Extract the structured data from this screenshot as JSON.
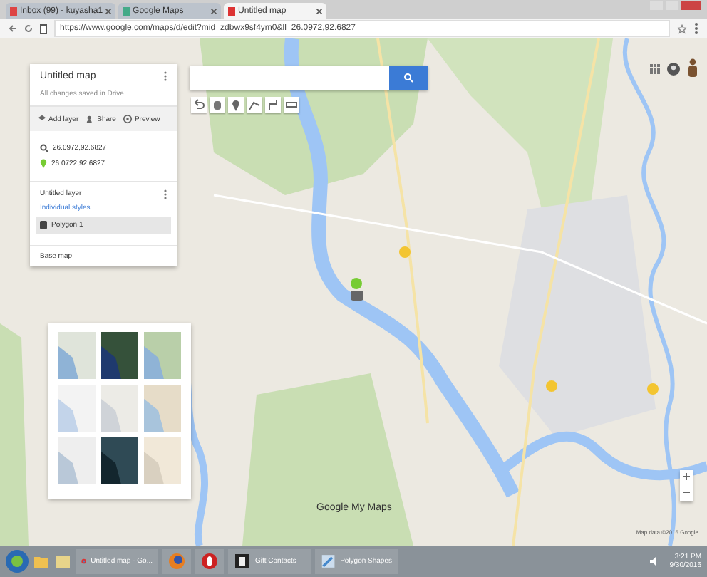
{
  "browser": {
    "tabs": [
      {
        "label": "Inbox (99) - kuyasha1",
        "selected": false
      },
      {
        "label": "Google Maps",
        "selected": false
      },
      {
        "label": "Untitled map",
        "selected": true
      }
    ],
    "url": "https://www.google.com/maps/d/edit?mid=zdbwx9sf4ym0&ll=26.0972,92.6827"
  },
  "map_panel": {
    "title": "Untitled map",
    "subtitle": "All changes saved in Drive",
    "actions": [
      {
        "kind": "layer",
        "label": "Add layer"
      },
      {
        "kind": "share",
        "label": "Share"
      },
      {
        "kind": "preview",
        "label": "Preview"
      }
    ],
    "directions": [
      {
        "kind": "search",
        "text": "26.0972,92.6827"
      },
      {
        "kind": "pin",
        "text": "26.0722,92.6827"
      }
    ],
    "layer": {
      "title": "Untitled layer",
      "style_link": "Individual styles",
      "features": [
        {
          "label": "Polygon 1",
          "selected": true
        }
      ]
    },
    "base_map": {
      "title": "Base map"
    }
  },
  "map": {
    "logo": "Google My Maps",
    "attribution": "Map data ©2016 Google"
  },
  "taskbar": {
    "items": [
      {
        "kind": "chrome",
        "label": "Untitled map - Go..."
      },
      {
        "kind": "firefox"
      },
      {
        "kind": "opera"
      },
      {
        "kind": "d",
        "label": "Gift Contacts"
      },
      {
        "kind": "paint",
        "label": "Polygon Shapes"
      }
    ],
    "time": "3:21 PM",
    "date": "9/30/2016"
  }
}
